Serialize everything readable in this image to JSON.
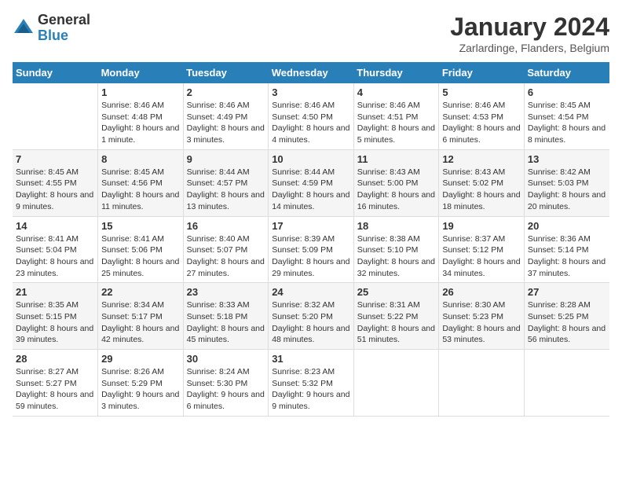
{
  "header": {
    "logo": {
      "line1": "General",
      "line2": "Blue"
    },
    "title": "January 2024",
    "subtitle": "Zarlardinge, Flanders, Belgium"
  },
  "calendar": {
    "days_of_week": [
      "Sunday",
      "Monday",
      "Tuesday",
      "Wednesday",
      "Thursday",
      "Friday",
      "Saturday"
    ],
    "weeks": [
      [
        {
          "day": "",
          "info": ""
        },
        {
          "day": "1",
          "info": "Sunrise: 8:46 AM\nSunset: 4:48 PM\nDaylight: 8 hours\nand 1 minute."
        },
        {
          "day": "2",
          "info": "Sunrise: 8:46 AM\nSunset: 4:49 PM\nDaylight: 8 hours\nand 3 minutes."
        },
        {
          "day": "3",
          "info": "Sunrise: 8:46 AM\nSunset: 4:50 PM\nDaylight: 8 hours\nand 4 minutes."
        },
        {
          "day": "4",
          "info": "Sunrise: 8:46 AM\nSunset: 4:51 PM\nDaylight: 8 hours\nand 5 minutes."
        },
        {
          "day": "5",
          "info": "Sunrise: 8:46 AM\nSunset: 4:53 PM\nDaylight: 8 hours\nand 6 minutes."
        },
        {
          "day": "6",
          "info": "Sunrise: 8:45 AM\nSunset: 4:54 PM\nDaylight: 8 hours\nand 8 minutes."
        }
      ],
      [
        {
          "day": "7",
          "info": "Sunrise: 8:45 AM\nSunset: 4:55 PM\nDaylight: 8 hours\nand 9 minutes."
        },
        {
          "day": "8",
          "info": "Sunrise: 8:45 AM\nSunset: 4:56 PM\nDaylight: 8 hours\nand 11 minutes."
        },
        {
          "day": "9",
          "info": "Sunrise: 8:44 AM\nSunset: 4:57 PM\nDaylight: 8 hours\nand 13 minutes."
        },
        {
          "day": "10",
          "info": "Sunrise: 8:44 AM\nSunset: 4:59 PM\nDaylight: 8 hours\nand 14 minutes."
        },
        {
          "day": "11",
          "info": "Sunrise: 8:43 AM\nSunset: 5:00 PM\nDaylight: 8 hours\nand 16 minutes."
        },
        {
          "day": "12",
          "info": "Sunrise: 8:43 AM\nSunset: 5:02 PM\nDaylight: 8 hours\nand 18 minutes."
        },
        {
          "day": "13",
          "info": "Sunrise: 8:42 AM\nSunset: 5:03 PM\nDaylight: 8 hours\nand 20 minutes."
        }
      ],
      [
        {
          "day": "14",
          "info": "Sunrise: 8:41 AM\nSunset: 5:04 PM\nDaylight: 8 hours\nand 23 minutes."
        },
        {
          "day": "15",
          "info": "Sunrise: 8:41 AM\nSunset: 5:06 PM\nDaylight: 8 hours\nand 25 minutes."
        },
        {
          "day": "16",
          "info": "Sunrise: 8:40 AM\nSunset: 5:07 PM\nDaylight: 8 hours\nand 27 minutes."
        },
        {
          "day": "17",
          "info": "Sunrise: 8:39 AM\nSunset: 5:09 PM\nDaylight: 8 hours\nand 29 minutes."
        },
        {
          "day": "18",
          "info": "Sunrise: 8:38 AM\nSunset: 5:10 PM\nDaylight: 8 hours\nand 32 minutes."
        },
        {
          "day": "19",
          "info": "Sunrise: 8:37 AM\nSunset: 5:12 PM\nDaylight: 8 hours\nand 34 minutes."
        },
        {
          "day": "20",
          "info": "Sunrise: 8:36 AM\nSunset: 5:14 PM\nDaylight: 8 hours\nand 37 minutes."
        }
      ],
      [
        {
          "day": "21",
          "info": "Sunrise: 8:35 AM\nSunset: 5:15 PM\nDaylight: 8 hours\nand 39 minutes."
        },
        {
          "day": "22",
          "info": "Sunrise: 8:34 AM\nSunset: 5:17 PM\nDaylight: 8 hours\nand 42 minutes."
        },
        {
          "day": "23",
          "info": "Sunrise: 8:33 AM\nSunset: 5:18 PM\nDaylight: 8 hours\nand 45 minutes."
        },
        {
          "day": "24",
          "info": "Sunrise: 8:32 AM\nSunset: 5:20 PM\nDaylight: 8 hours\nand 48 minutes."
        },
        {
          "day": "25",
          "info": "Sunrise: 8:31 AM\nSunset: 5:22 PM\nDaylight: 8 hours\nand 51 minutes."
        },
        {
          "day": "26",
          "info": "Sunrise: 8:30 AM\nSunset: 5:23 PM\nDaylight: 8 hours\nand 53 minutes."
        },
        {
          "day": "27",
          "info": "Sunrise: 8:28 AM\nSunset: 5:25 PM\nDaylight: 8 hours\nand 56 minutes."
        }
      ],
      [
        {
          "day": "28",
          "info": "Sunrise: 8:27 AM\nSunset: 5:27 PM\nDaylight: 8 hours\nand 59 minutes."
        },
        {
          "day": "29",
          "info": "Sunrise: 8:26 AM\nSunset: 5:29 PM\nDaylight: 9 hours\nand 3 minutes."
        },
        {
          "day": "30",
          "info": "Sunrise: 8:24 AM\nSunset: 5:30 PM\nDaylight: 9 hours\nand 6 minutes."
        },
        {
          "day": "31",
          "info": "Sunrise: 8:23 AM\nSunset: 5:32 PM\nDaylight: 9 hours\nand 9 minutes."
        },
        {
          "day": "",
          "info": ""
        },
        {
          "day": "",
          "info": ""
        },
        {
          "day": "",
          "info": ""
        }
      ]
    ]
  }
}
